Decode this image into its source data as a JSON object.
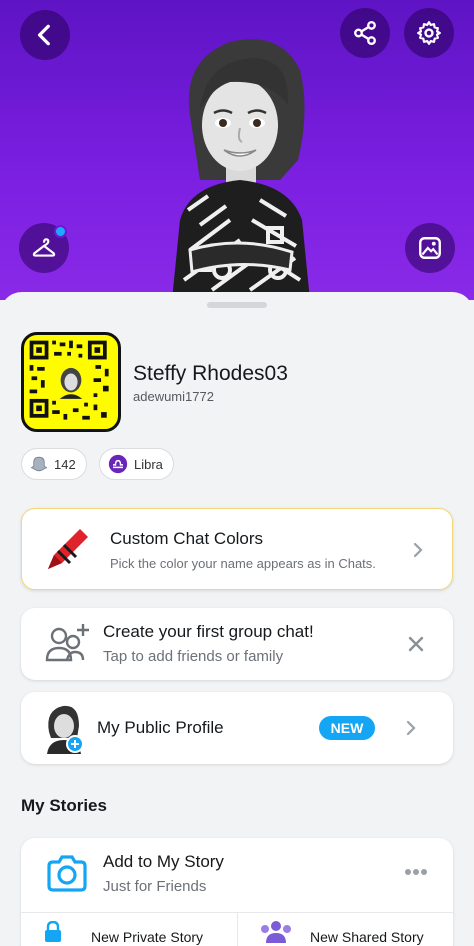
{
  "header": {
    "back_icon": "chevron-left-icon",
    "share_icon": "share-icon",
    "settings_icon": "gear-icon",
    "outfit_icon": "hanger-icon",
    "background_icon": "image-frame-icon"
  },
  "profile": {
    "display_name": "Steffy Rhodes03",
    "username": "adewumi1772",
    "snap_score": "142",
    "zodiac": "Libra"
  },
  "cards": {
    "chat_colors": {
      "title": "Custom Chat Colors",
      "subtitle": "Pick the color your name appears as in Chats."
    },
    "group_chat": {
      "title": "Create your first group chat!",
      "subtitle": "Tap to add friends or family"
    },
    "public_profile": {
      "title": "My Public Profile",
      "badge": "NEW"
    }
  },
  "stories": {
    "section_title": "My Stories",
    "add_story_title": "Add to My Story",
    "add_story_subtitle": "Just for Friends",
    "new_private": "New Private Story",
    "new_shared": "New Shared Story"
  },
  "colors": {
    "hero_purple": "#7a1ee0",
    "snap_yellow": "#fffc00",
    "accent_blue": "#14a6f5"
  }
}
